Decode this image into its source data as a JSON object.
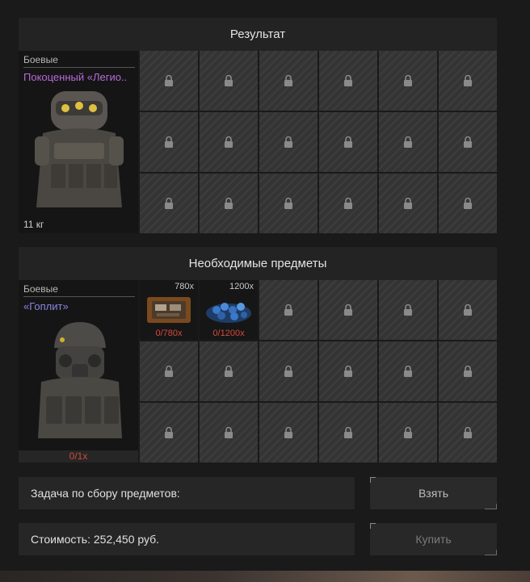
{
  "result_panel": {
    "header": "Результат",
    "item": {
      "category": "Боевые",
      "name": "Покоценный «Легио..",
      "weight": "11 кг",
      "color": "#b86ad8"
    },
    "locked_slots": 18
  },
  "required_panel": {
    "header": "Необходимые предметы",
    "item": {
      "category": "Боевые",
      "name": "«Гоплит»",
      "progress": "0/1x",
      "color": "#8a86e0"
    },
    "materials": [
      {
        "count": "780x",
        "progress": "0/780x",
        "icon": "component-case-icon"
      },
      {
        "count": "1200x",
        "progress": "0/1200x",
        "icon": "blue-crystals-icon"
      }
    ],
    "locked_slots": 16
  },
  "task": {
    "label": "Задача по сбору предметов:"
  },
  "cost": {
    "label": "Стоимость: 252,450 руб."
  },
  "buttons": {
    "take": "Взять",
    "buy": "Купить"
  },
  "colors": {
    "progress_red": "#d44a3a",
    "panel": "#232323",
    "slot": "#343434"
  }
}
